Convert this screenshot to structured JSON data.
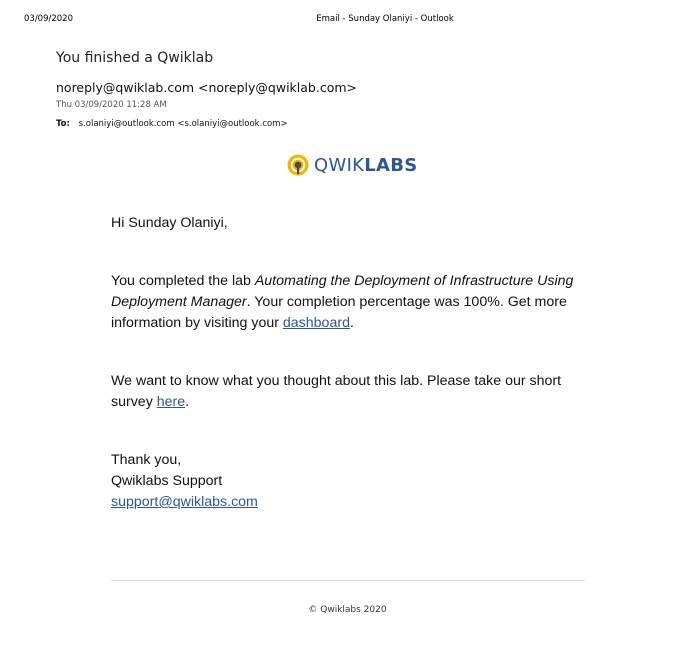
{
  "print_header": {
    "date": "03/09/2020",
    "title": "Email - Sunday Olaniyi - Outlook"
  },
  "email": {
    "subject": "You finished a Qwiklab",
    "sender": "noreply@qwiklab.com <noreply@qwiklab.com>",
    "sent_date": "Thu 03/09/2020 11:28 AM",
    "to_label": "To:",
    "to_value": "s.olaniyi@outlook.com <s.olaniyi@outlook.com>"
  },
  "logo": {
    "text_light": "QWIK",
    "text_bold": "LABS",
    "icon": "qwiklabs-logo-icon",
    "colors": {
      "text": "#2f5597",
      "icon_ring": "#f4b400",
      "icon_inner": "#4a4a4a"
    }
  },
  "body": {
    "greeting": "Hi Sunday Olaniyi,",
    "p1_before": "You completed the lab ",
    "p1_lab": "Automating the Deployment of Infrastructure Using Deployment Manager",
    "p1_after": ". Your completion percentage was 100%. Get more information by visiting your ",
    "p1_link": "dashboard",
    "p1_end": ".",
    "p2_before": "We want to know what you thought about this lab. Please take our short survey ",
    "p2_link": "here",
    "p2_end": ".",
    "signoff_1": "Thank you,",
    "signoff_2": "Qwiklabs Support",
    "support_email": "support@qwiklabs.com"
  },
  "footer": {
    "copyright": "© Qwiklabs 2020"
  },
  "colors": {
    "link": "#2f5597",
    "divider": "#d9d9d9"
  }
}
